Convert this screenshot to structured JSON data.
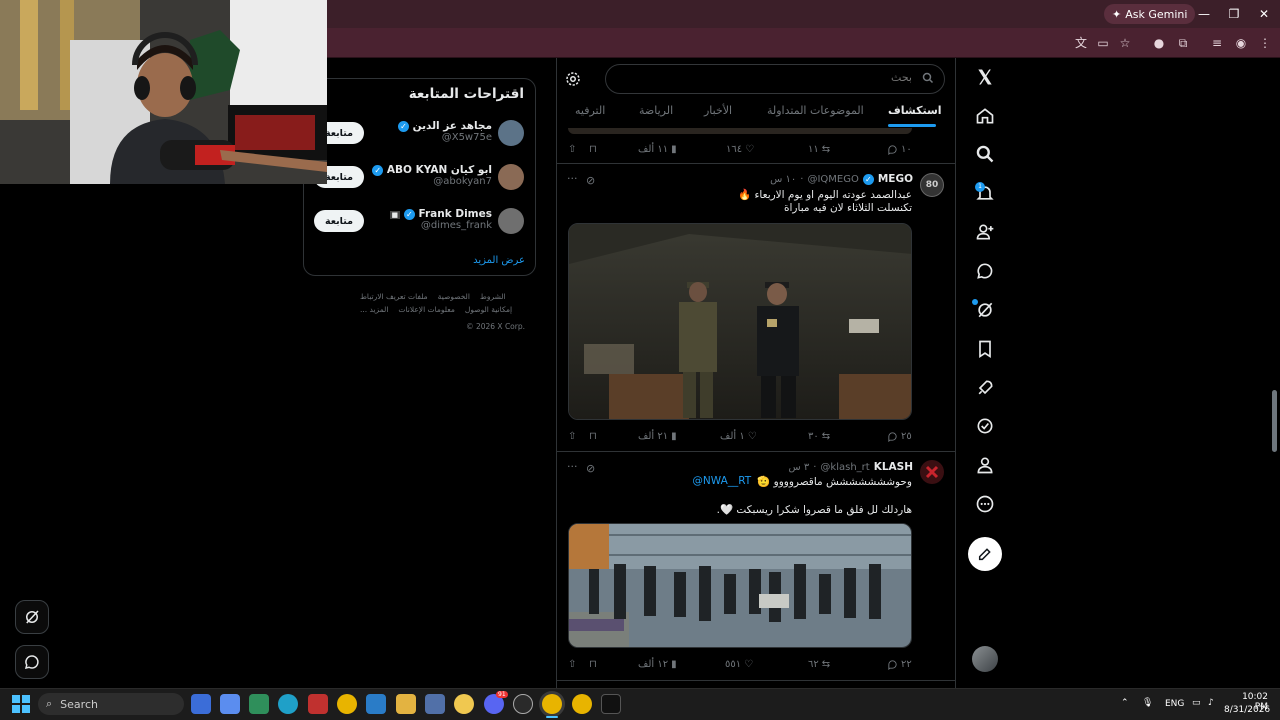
{
  "browser": {
    "ask_gemini": "Ask Gemini"
  },
  "search": {
    "placeholder": "بحث"
  },
  "tabs": [
    {
      "label": "استكشاف",
      "active": true
    },
    {
      "label": "الموضوعات المتداولة"
    },
    {
      "label": "الأخبار"
    },
    {
      "label": "الرياضة"
    },
    {
      "label": "الترفيه"
    }
  ],
  "prev_tweet_actions": {
    "replies": "١٠",
    "reposts": "١١",
    "likes": "١٦٤",
    "views": "١١ ألف"
  },
  "tweets": [
    {
      "name": "MEGO",
      "handle": "@IQMEGO",
      "time": "١٠ س",
      "line1": "عبدالصمد عودته اليوم او يوم الاربعاء 🔥",
      "line2": "تكنسلت الثلاثاء لان فيه مباراة",
      "avatar_text": "80",
      "replies": "٢٥",
      "reposts": "٣٠",
      "likes": "١ ألف",
      "views": "٢١ ألف"
    },
    {
      "name": "KLASH",
      "handle": "@klash_rt",
      "time": "٣ س",
      "line1": "وحوششششششش ماقصروووو 🫡",
      "mention": "@NWA__RT",
      "line2": "هاردلك لل فلق ما قصروا شكرا ريسبكت 🤍.",
      "replies": "٢٢",
      "reposts": "٦٢",
      "likes": "٥٥١",
      "views": "١٢ ألف"
    }
  ],
  "suggestions": {
    "title": "اقتراحات المتابعة",
    "follow_label": "متابعة",
    "items": [
      {
        "name": "مجاهد عز الدين",
        "handle": "@X5w75e",
        "avatar_color": "#5c7388"
      },
      {
        "name": "ABO KYAN ابو كيان",
        "handle": "@abokyan7",
        "avatar_color": "#8a6a55"
      },
      {
        "name": "Frank Dimes",
        "handle": "@dimes_frank",
        "avatar_color": "#6f6f6f"
      }
    ],
    "show_more": "عرض المزيد"
  },
  "footer": {
    "links": [
      "الشروط",
      "الخصوصية",
      "ملفات تعريف الارتباط",
      "إمكانية الوصول",
      "معلومات الإعلانات",
      "المزيد ..."
    ],
    "copyright": "© 2026 X Corp."
  },
  "taskbar": {
    "search_label": "Search",
    "lang": "ENG",
    "time": "10:02 PM",
    "date": "8/31/2026",
    "badge_discord": "91"
  },
  "colors": {
    "accent": "#1d9bf0",
    "chrome": "#3c1f29"
  }
}
